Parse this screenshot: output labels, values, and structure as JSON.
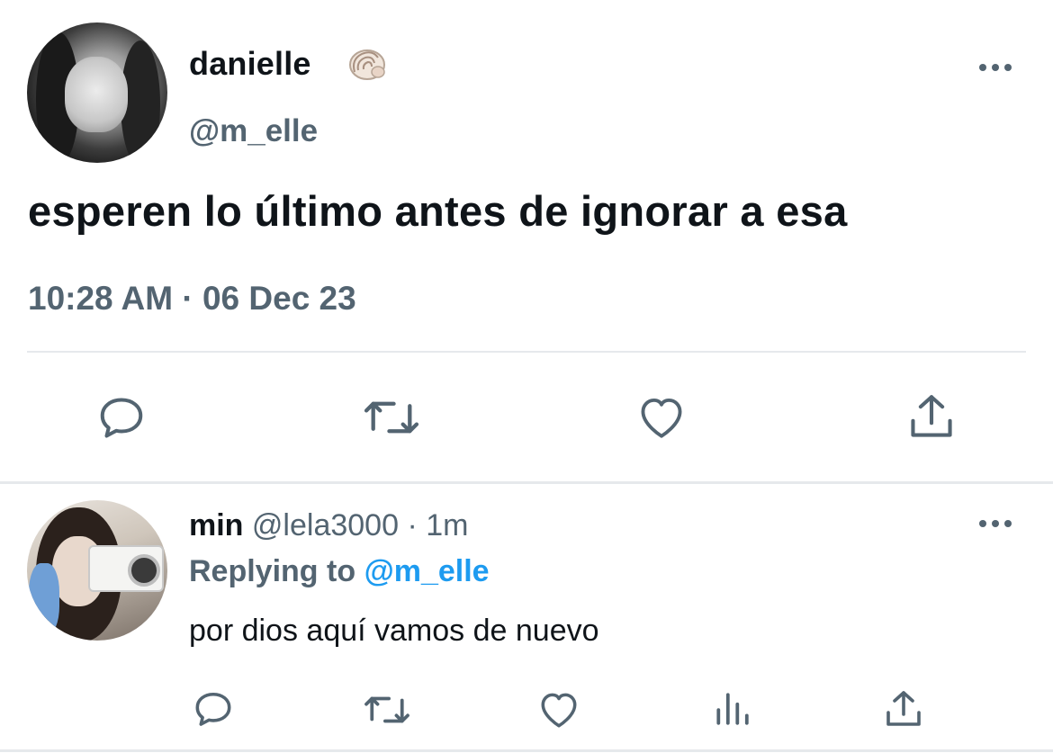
{
  "tweet": {
    "author_name": "danielle",
    "author_handle": "@m_elle",
    "text": "esperen lo último antes de ignorar a esa",
    "timestamp": "10:28 AM · 06 Dec 23",
    "name_emoji_icon": "spiral-shell-icon",
    "actions": [
      "reply-icon",
      "retweet-icon",
      "like-icon",
      "share-icon"
    ]
  },
  "reply": {
    "author_name": "min",
    "author_handle": "@lela3000",
    "separator": "·",
    "time": "1m",
    "replying_prefix": "Replying to",
    "replying_to": "@m_elle",
    "text": "por dios aquí vamos de nuevo",
    "actions": [
      "reply-icon",
      "retweet-icon",
      "like-icon",
      "analytics-icon",
      "share-icon"
    ]
  },
  "colors": {
    "text_primary": "#0f1419",
    "text_secondary": "#536471",
    "link": "#1d9bf0",
    "divider": "#e6e9ec",
    "background": "#ffffff"
  }
}
